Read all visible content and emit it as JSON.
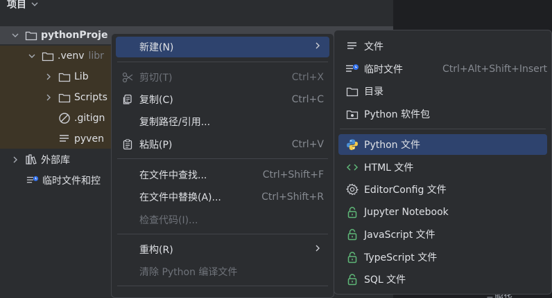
{
  "panel": {
    "title": "项目"
  },
  "tree": {
    "root": {
      "label": "pythonProje"
    },
    "venv": {
      "label": ".venv",
      "suffix": "libr"
    },
    "lib": {
      "label": "Lib"
    },
    "scripts": {
      "label": "Scripts"
    },
    "gitignore": {
      "label": ".gitign"
    },
    "pyvenv": {
      "label": "pyven"
    },
    "external": {
      "label": "外部库"
    },
    "scratches": {
      "label": "临时文件和控"
    }
  },
  "context_menu": {
    "new": {
      "label": "新建(N)"
    },
    "cut": {
      "label": "剪切(T)",
      "shortcut": "Ctrl+X"
    },
    "copy": {
      "label": "复制(C)",
      "shortcut": "Ctrl+C"
    },
    "copy_path": {
      "label": "复制路径/引用..."
    },
    "paste": {
      "label": "粘贴(P)",
      "shortcut": "Ctrl+V"
    },
    "find_in_files": {
      "label": "在文件中查找...",
      "shortcut": "Ctrl+Shift+F"
    },
    "replace_in_files": {
      "label": "在文件中替换(A)...",
      "shortcut": "Ctrl+Shift+R"
    },
    "inspect_code": {
      "label": "检查代码(I)..."
    },
    "refactor": {
      "label": "重构(R)"
    },
    "clean_python": {
      "label": "清除 Python 编译文件"
    }
  },
  "submenu": {
    "file": {
      "label": "文件"
    },
    "scratch_file": {
      "label": "临时文件",
      "shortcut": "Ctrl+Alt+Shift+Insert"
    },
    "directory": {
      "label": "目录"
    },
    "python_package": {
      "label": "Python 软件包"
    },
    "python_file": {
      "label": "Python 文件"
    },
    "html_file": {
      "label": "HTML 文件"
    },
    "editorconfig": {
      "label": "EditorConfig 文件"
    },
    "jupyter": {
      "label": "Jupyter Notebook"
    },
    "javascript": {
      "label": "JavaScript 文件"
    },
    "typescript": {
      "label": "TypeScript 文件"
    },
    "sql": {
      "label": "SQL 文件"
    }
  },
  "colors": {
    "accent": "#2e436e",
    "lock_icon": "#5fb878",
    "html_icon": "#5fb878",
    "python_blue": "#4a8fd6",
    "python_yellow": "#f2c94c"
  },
  "editor_edge_text": "三服华"
}
